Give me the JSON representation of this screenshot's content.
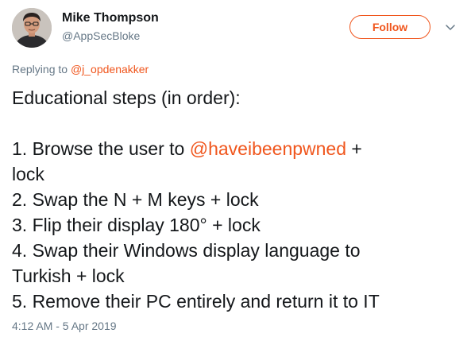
{
  "author": {
    "display_name": "Mike Thompson",
    "handle": "@AppSecBloke",
    "avatar_icon": "profile-photo"
  },
  "follow_button": {
    "label": "Follow"
  },
  "menu": {
    "icon": "chevron-down-icon"
  },
  "reply": {
    "prefix": "Replying to ",
    "mention": "@j_opdenakker"
  },
  "tweet": {
    "heading": "Educational steps (in order):",
    "lines": [
      {
        "before": "1. Browse the user to ",
        "mention": "@haveibeenpwned",
        "after": " +"
      },
      {
        "text": "lock"
      },
      {
        "text": "2. Swap the N + M keys + lock"
      },
      {
        "text": "3. Flip their display 180° + lock"
      },
      {
        "text": "4. Swap their Windows display language to"
      },
      {
        "text": "Turkish + lock"
      },
      {
        "text": "5. Remove their PC entirely and return it to IT"
      }
    ]
  },
  "timestamp": "4:12 AM - 5 Apr 2019",
  "colors": {
    "accent": "#f0561d",
    "text": "#14171a",
    "muted": "#657786"
  }
}
